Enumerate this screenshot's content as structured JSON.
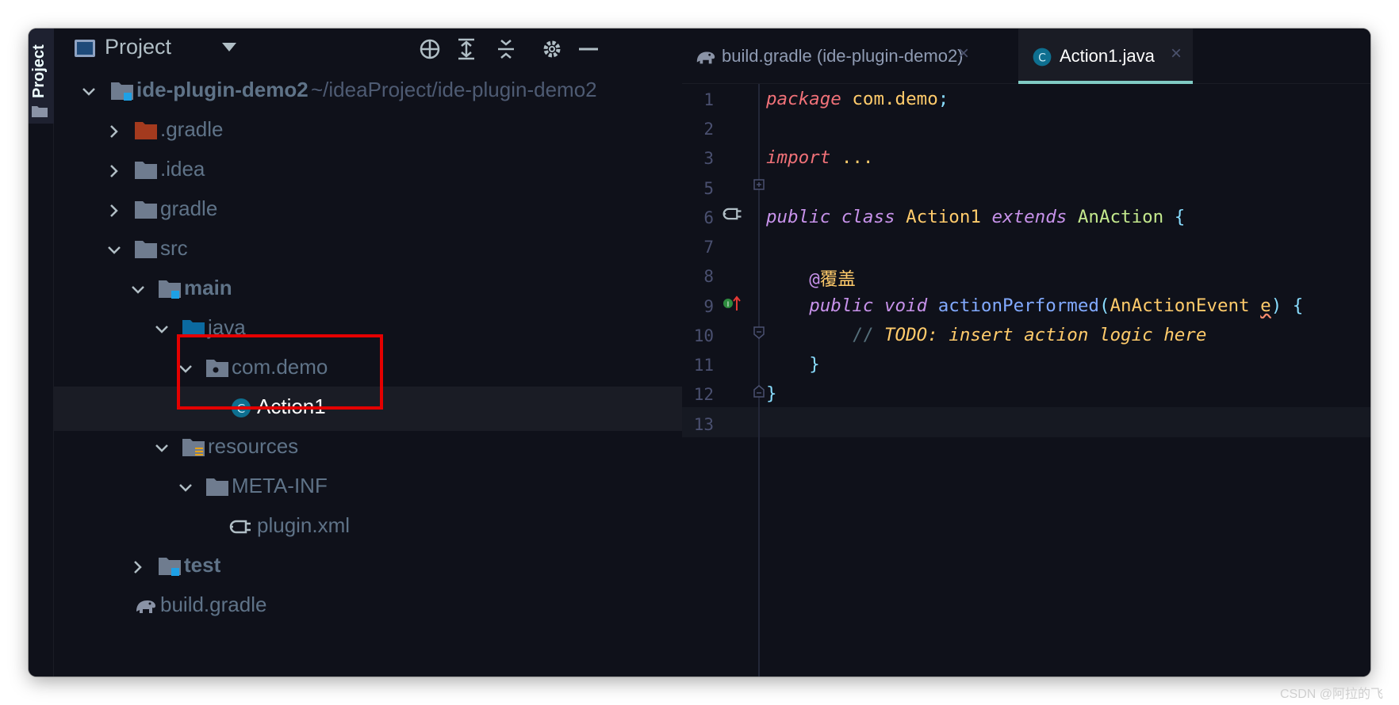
{
  "stripe": {
    "label": "Project"
  },
  "panel": {
    "title": "Project",
    "toolbar": [
      "locate-icon",
      "expand-all-icon",
      "collapse-all-icon",
      "gear-icon",
      "hide-icon"
    ]
  },
  "tree": {
    "root": {
      "name": "ide-plugin-demo2",
      "path": "~/ideaProject/ide-plugin-demo2"
    },
    "items": [
      {
        "label": ".gradle"
      },
      {
        "label": ".idea"
      },
      {
        "label": "gradle"
      },
      {
        "label": "src"
      },
      {
        "label": "main"
      },
      {
        "label": "java"
      },
      {
        "label": "com.demo"
      },
      {
        "label": "Action1"
      },
      {
        "label": "resources"
      },
      {
        "label": "META-INF"
      },
      {
        "label": "plugin.xml"
      },
      {
        "label": "test"
      },
      {
        "label": "build.gradle"
      }
    ]
  },
  "editor": {
    "tabs": [
      {
        "label": "build.gradle (ide-plugin-demo2)",
        "active": false
      },
      {
        "label": "Action1.java",
        "active": true
      }
    ],
    "close_glyph": "×",
    "line_numbers": [
      "1",
      "2",
      "3",
      "5",
      "6",
      "7",
      "8",
      "9",
      "10",
      "11",
      "12",
      "13"
    ],
    "code": {
      "l1_kw": "package",
      "l1_pkg": "com.demo",
      "l1_semi": ";",
      "l3_kw": "import",
      "l3_dots": "...",
      "l6_public": "public",
      "l6_class": "class",
      "l6_name": "Action1",
      "l6_extends": "extends",
      "l6_super": "AnAction",
      "l6_brace": "{",
      "l8_at": "@",
      "l8_ann": "覆盖",
      "l9_public": "public",
      "l9_void": "void",
      "l9_method": "actionPerformed",
      "l9_open": "(",
      "l9_type": "AnActionEvent",
      "l9_param": "e",
      "l9_close": ")",
      "l9_brace": "{",
      "l10_slashes": "//",
      "l10_todo": "TODO: insert action logic here",
      "l11_brace": "}",
      "l12_brace": "}"
    }
  },
  "colors": {
    "background": "#0f111a",
    "keyword": "#c792ea",
    "string_like": "#ffcb6b",
    "function": "#82aaff",
    "punctuation": "#89ddff",
    "highlight_box": "#e40000",
    "active_tab_underline": "#80cbc4"
  },
  "watermark": "CSDN @阿拉的飞"
}
